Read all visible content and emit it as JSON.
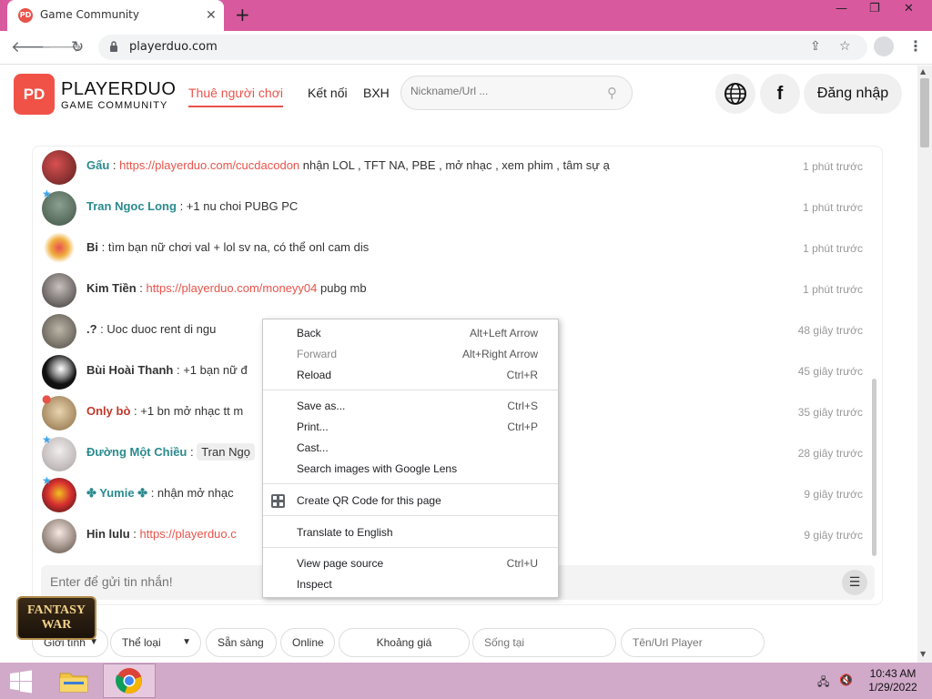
{
  "browser": {
    "tab_title": "Game Community",
    "tab_close": "✕",
    "new_tab": "+",
    "url": "playerduo.com",
    "window_minimize": "—",
    "window_restore": "❐",
    "window_close": "✕"
  },
  "site": {
    "logo_text": "PD",
    "brand_name": "PLAYERDUO",
    "brand_sub": "GAME COMMUNITY",
    "nav": [
      {
        "label": "Thuê người chơi",
        "active": true
      },
      {
        "label": "Kết nối"
      },
      {
        "label": "BXH"
      }
    ],
    "search_placeholder": "Nickname/Url ...",
    "facebook_glyph": "f",
    "login_label": "Đăng nhập"
  },
  "chat": {
    "messages": [
      {
        "name": "Gấu",
        "sep": " : ",
        "link": "https://playerduo.com/cucdacodon",
        "text": " nhận LOL , TFT NA, PBE , mở nhạc , xem phim , tâm sự ạ",
        "time": "1 phút trước"
      },
      {
        "name": "Tran Ngoc Long",
        "sep": " : ",
        "text": "+1 nu choi PUBG PC",
        "time": "1 phút trước"
      },
      {
        "name": "Bi",
        "sep": " : ",
        "text": "tìm bạn nữ chơi val + lol sv na, có thể onl cam dis",
        "time": "1 phút trước"
      },
      {
        "name": "Kim Tiền",
        "sep": " : ",
        "link": "https://playerduo.com/moneyy04",
        "text": " pubg mb",
        "time": "1 phút trước"
      },
      {
        "name": ".?",
        "sep": " : ",
        "text": "Uoc duoc rent di ngu",
        "time": "48 giây trước"
      },
      {
        "name": "Bùi Hoài Thanh",
        "sep": " : ",
        "text": "+1 bạn nữ đ",
        "time": "45 giây trước"
      },
      {
        "name": "Only bò",
        "sep": " : ",
        "text": "+1 bn mở nhạc tt m",
        "time": "35 giây trước"
      },
      {
        "name": "Đường Một Chiều",
        "sep": " : ",
        "chip": "Tran Ngọ",
        "time": "28 giây trước"
      },
      {
        "name": "✤ Yumie ✤",
        "sep": " : ",
        "text": "nhận mở nhạc",
        "time": "9 giây trước"
      },
      {
        "name": "Hin lulu",
        "sep": " : ",
        "link": "https://playerduo.c",
        "time": "9 giây trước"
      }
    ],
    "input_placeholder": "Enter để gửi tin nhắn!"
  },
  "filters": [
    {
      "label": "Giới tính",
      "dropdown": true
    },
    {
      "label": "Thể loại",
      "dropdown": true
    },
    {
      "label": "Sẵn sàng"
    },
    {
      "label": "Online"
    },
    {
      "label": "Khoảng giá"
    },
    {
      "placeholder": "Sống tại"
    },
    {
      "placeholder": "Tên/Url Player"
    }
  ],
  "ad_badge": "FANTASY WAR",
  "context_menu": [
    {
      "label": "Back",
      "shortcut": "Alt+Left Arrow"
    },
    {
      "label": "Forward",
      "shortcut": "Alt+Right Arrow",
      "disabled": true
    },
    {
      "label": "Reload",
      "shortcut": "Ctrl+R"
    },
    {
      "label": "Save as...",
      "shortcut": "Ctrl+S"
    },
    {
      "label": "Print...",
      "shortcut": "Ctrl+P"
    },
    {
      "label": "Cast..."
    },
    {
      "label": "Search images with Google Lens"
    },
    {
      "label": "Create QR Code for this page",
      "icon": "qr-code-icon"
    },
    {
      "label": "Translate to English"
    },
    {
      "label": "View page source",
      "shortcut": "Ctrl+U"
    },
    {
      "label": "Inspect"
    }
  ],
  "taskbar": {
    "time": "10:43 AM",
    "date": "1/29/2022"
  },
  "colors": {
    "tabbar": "#d9599e",
    "brand_red": "#e8534a",
    "teal_name": "#2a8b8f",
    "taskbar": "#d1aaca"
  }
}
